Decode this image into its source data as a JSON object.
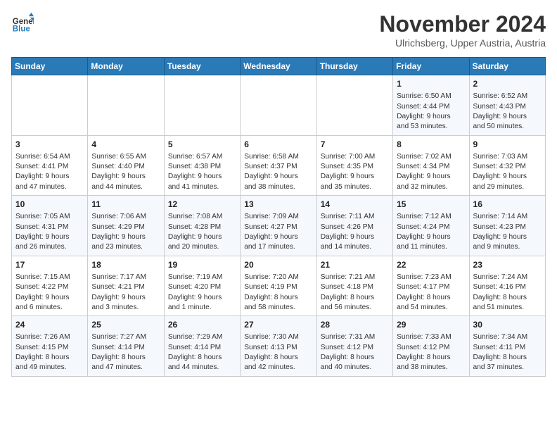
{
  "header": {
    "logo_line1": "General",
    "logo_line2": "Blue",
    "month_title": "November 2024",
    "location": "Ulrichsberg, Upper Austria, Austria"
  },
  "weekdays": [
    "Sunday",
    "Monday",
    "Tuesday",
    "Wednesday",
    "Thursday",
    "Friday",
    "Saturday"
  ],
  "weeks": [
    [
      {
        "day": "",
        "info": ""
      },
      {
        "day": "",
        "info": ""
      },
      {
        "day": "",
        "info": ""
      },
      {
        "day": "",
        "info": ""
      },
      {
        "day": "",
        "info": ""
      },
      {
        "day": "1",
        "info": "Sunrise: 6:50 AM\nSunset: 4:44 PM\nDaylight: 9 hours\nand 53 minutes."
      },
      {
        "day": "2",
        "info": "Sunrise: 6:52 AM\nSunset: 4:43 PM\nDaylight: 9 hours\nand 50 minutes."
      }
    ],
    [
      {
        "day": "3",
        "info": "Sunrise: 6:54 AM\nSunset: 4:41 PM\nDaylight: 9 hours\nand 47 minutes."
      },
      {
        "day": "4",
        "info": "Sunrise: 6:55 AM\nSunset: 4:40 PM\nDaylight: 9 hours\nand 44 minutes."
      },
      {
        "day": "5",
        "info": "Sunrise: 6:57 AM\nSunset: 4:38 PM\nDaylight: 9 hours\nand 41 minutes."
      },
      {
        "day": "6",
        "info": "Sunrise: 6:58 AM\nSunset: 4:37 PM\nDaylight: 9 hours\nand 38 minutes."
      },
      {
        "day": "7",
        "info": "Sunrise: 7:00 AM\nSunset: 4:35 PM\nDaylight: 9 hours\nand 35 minutes."
      },
      {
        "day": "8",
        "info": "Sunrise: 7:02 AM\nSunset: 4:34 PM\nDaylight: 9 hours\nand 32 minutes."
      },
      {
        "day": "9",
        "info": "Sunrise: 7:03 AM\nSunset: 4:32 PM\nDaylight: 9 hours\nand 29 minutes."
      }
    ],
    [
      {
        "day": "10",
        "info": "Sunrise: 7:05 AM\nSunset: 4:31 PM\nDaylight: 9 hours\nand 26 minutes."
      },
      {
        "day": "11",
        "info": "Sunrise: 7:06 AM\nSunset: 4:29 PM\nDaylight: 9 hours\nand 23 minutes."
      },
      {
        "day": "12",
        "info": "Sunrise: 7:08 AM\nSunset: 4:28 PM\nDaylight: 9 hours\nand 20 minutes."
      },
      {
        "day": "13",
        "info": "Sunrise: 7:09 AM\nSunset: 4:27 PM\nDaylight: 9 hours\nand 17 minutes."
      },
      {
        "day": "14",
        "info": "Sunrise: 7:11 AM\nSunset: 4:26 PM\nDaylight: 9 hours\nand 14 minutes."
      },
      {
        "day": "15",
        "info": "Sunrise: 7:12 AM\nSunset: 4:24 PM\nDaylight: 9 hours\nand 11 minutes."
      },
      {
        "day": "16",
        "info": "Sunrise: 7:14 AM\nSunset: 4:23 PM\nDaylight: 9 hours\nand 9 minutes."
      }
    ],
    [
      {
        "day": "17",
        "info": "Sunrise: 7:15 AM\nSunset: 4:22 PM\nDaylight: 9 hours\nand 6 minutes."
      },
      {
        "day": "18",
        "info": "Sunrise: 7:17 AM\nSunset: 4:21 PM\nDaylight: 9 hours\nand 3 minutes."
      },
      {
        "day": "19",
        "info": "Sunrise: 7:19 AM\nSunset: 4:20 PM\nDaylight: 9 hours\nand 1 minute."
      },
      {
        "day": "20",
        "info": "Sunrise: 7:20 AM\nSunset: 4:19 PM\nDaylight: 8 hours\nand 58 minutes."
      },
      {
        "day": "21",
        "info": "Sunrise: 7:21 AM\nSunset: 4:18 PM\nDaylight: 8 hours\nand 56 minutes."
      },
      {
        "day": "22",
        "info": "Sunrise: 7:23 AM\nSunset: 4:17 PM\nDaylight: 8 hours\nand 54 minutes."
      },
      {
        "day": "23",
        "info": "Sunrise: 7:24 AM\nSunset: 4:16 PM\nDaylight: 8 hours\nand 51 minutes."
      }
    ],
    [
      {
        "day": "24",
        "info": "Sunrise: 7:26 AM\nSunset: 4:15 PM\nDaylight: 8 hours\nand 49 minutes."
      },
      {
        "day": "25",
        "info": "Sunrise: 7:27 AM\nSunset: 4:14 PM\nDaylight: 8 hours\nand 47 minutes."
      },
      {
        "day": "26",
        "info": "Sunrise: 7:29 AM\nSunset: 4:14 PM\nDaylight: 8 hours\nand 44 minutes."
      },
      {
        "day": "27",
        "info": "Sunrise: 7:30 AM\nSunset: 4:13 PM\nDaylight: 8 hours\nand 42 minutes."
      },
      {
        "day": "28",
        "info": "Sunrise: 7:31 AM\nSunset: 4:12 PM\nDaylight: 8 hours\nand 40 minutes."
      },
      {
        "day": "29",
        "info": "Sunrise: 7:33 AM\nSunset: 4:12 PM\nDaylight: 8 hours\nand 38 minutes."
      },
      {
        "day": "30",
        "info": "Sunrise: 7:34 AM\nSunset: 4:11 PM\nDaylight: 8 hours\nand 37 minutes."
      }
    ]
  ]
}
